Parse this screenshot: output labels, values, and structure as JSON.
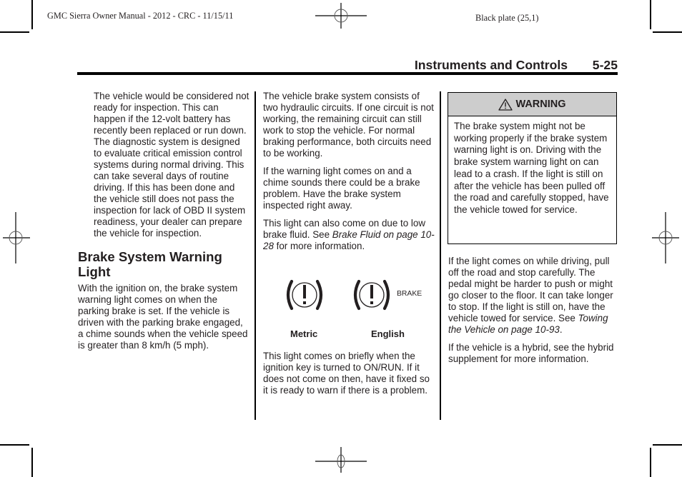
{
  "slug": {
    "left": "GMC Sierra Owner Manual - 2012 - CRC - 11/15/11",
    "right": "Black plate (25,1)"
  },
  "running_head": {
    "title": "Instruments and Controls",
    "page_number": "5-25"
  },
  "column1": {
    "intro_paragraph": "The vehicle would be considered not ready for inspection. This can happen if the 12-volt battery has recently been replaced or run down. The diagnostic system is designed to evaluate critical emission control systems during normal driving. This can take several days of routine driving. If this has been done and the vehicle still does not pass the inspection for lack of OBD II system readiness, your dealer can prepare the vehicle for inspection.",
    "section_heading": "Brake System Warning Light",
    "section_paragraph": "With the ignition on, the brake system warning light comes on when the parking brake is set. If the vehicle is driven with the parking brake engaged, a chime sounds when the vehicle speed is greater than 8 km/h (5 mph)."
  },
  "column2": {
    "p1": "The vehicle brake system consists of two hydraulic circuits. If one circuit is not working, the remaining circuit can still work to stop the vehicle. For normal braking performance, both circuits need to be working.",
    "p2": "If the warning light comes on and a chime sounds there could be a brake problem. Have the brake system inspected right away.",
    "p3_before": "This light can also come on due to low brake fluid. See ",
    "p3_link": "Brake Fluid on page 10-28",
    "p3_after": " for more information.",
    "icons": {
      "metric_icon": "brake-warning-circle-exclamation-icon",
      "english_icon": "brake-warning-circle-exclamation-icon",
      "english_text": "BRAKE",
      "metric_label": "Metric",
      "english_label": "English"
    },
    "p4": "This light comes on briefly when the ignition key is turned to ON/RUN. If it does not come on then, have it fixed so it is ready to warn if there is a problem."
  },
  "warning": {
    "icon": "warning-triangle-icon",
    "title": "WARNING",
    "body": "The brake system might not be working properly if the brake system warning light is on. Driving with the brake system warning light on can lead to a crash. If the light is still on after the vehicle has been pulled off the road and carefully stopped, have the vehicle towed for service.",
    "header_color": "#cdcdcd"
  },
  "column3": {
    "p1_before": "If the light comes on while driving, pull off the road and stop carefully. The pedal might be harder to push or might go closer to the floor. It can take longer to stop. If the light is still on, have the vehicle towed for service. See ",
    "p1_link": "Towing the Vehicle on page 10-93",
    "p1_after": ".",
    "p2": "If the vehicle is a hybrid, see the hybrid supplement for more information."
  }
}
